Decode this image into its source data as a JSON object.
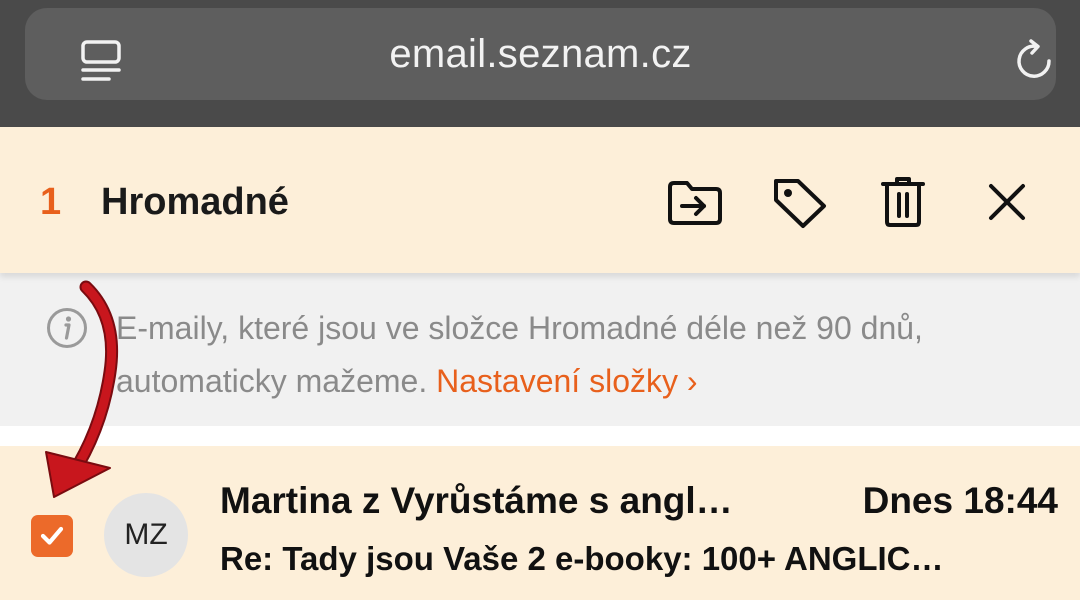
{
  "browser": {
    "url": "email.seznam.cz",
    "tabs_icon": "tabs-icon",
    "reload_icon": "reload-icon"
  },
  "toolbar": {
    "selected_count": "1",
    "folder_title": "Hromadné",
    "actions": [
      {
        "icon": "move-to-folder-icon"
      },
      {
        "icon": "tag-icon"
      },
      {
        "icon": "trash-icon"
      },
      {
        "icon": "close-icon"
      }
    ]
  },
  "notice": {
    "icon": "info-icon",
    "text": "E-maily, které jsou ve složce Hromadné déle než 90 dnů, automaticky mažeme. ",
    "link": "Nastavení složky ›"
  },
  "emails": [
    {
      "selected": true,
      "avatar_initials": "MZ",
      "sender": "Martina z Vyrůstáme s angl…",
      "time": "Dnes 18:44",
      "subject": "Re: Tady jsou Vaše 2 e-booky: 100+ ANGLIC…"
    }
  ],
  "colors": {
    "accent": "#e8601c",
    "toolbar_bg": "#fdefd9",
    "browser_bg": "#4a4a4a",
    "notice_bg": "#f1f1f1",
    "annotation_arrow": "#c8161d"
  }
}
